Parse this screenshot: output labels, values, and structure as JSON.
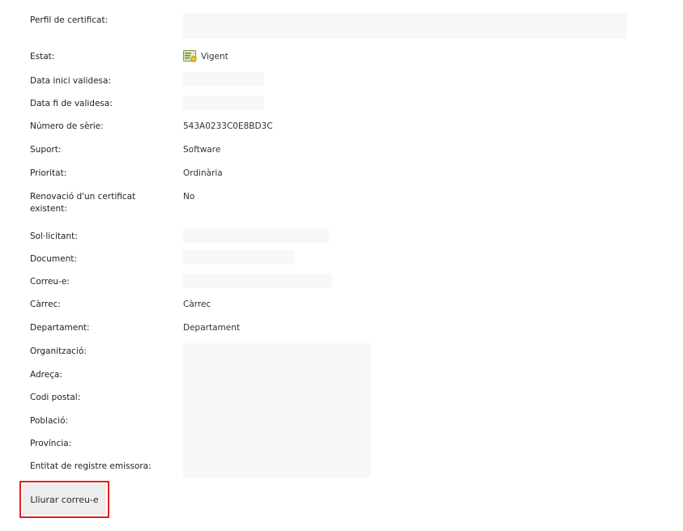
{
  "fields": {
    "perfil": {
      "label": "Perfil de certificat:"
    },
    "estat": {
      "label": "Estat:",
      "value": "Vigent",
      "icon": "certificate-icon"
    },
    "data_inici": {
      "label": "Data inici validesa:"
    },
    "data_fi": {
      "label": "Data fi de validesa:"
    },
    "numero_serie": {
      "label": "Número de sèrie:",
      "value": "543A0233C0E8BD3C"
    },
    "suport": {
      "label": "Suport:",
      "value": "Software"
    },
    "prioritat": {
      "label": "Prioritat:",
      "value": "Ordinària"
    },
    "renovacio": {
      "label": "Renovació d'un certificat existent:",
      "value": "No"
    },
    "sollicitant": {
      "label": "Sol·licitant:"
    },
    "document": {
      "label": "Document:"
    },
    "correu": {
      "label": "Correu-e:"
    },
    "carrec": {
      "label": "Càrrec:",
      "value": "Càrrec"
    },
    "departament": {
      "label": "Departament:",
      "value": "Departament"
    },
    "organitzacio": {
      "label": "Organització:"
    },
    "adreca": {
      "label": "Adreça:"
    },
    "codi_postal": {
      "label": "Codi postal:"
    },
    "poblacio": {
      "label": "Població:"
    },
    "provincia": {
      "label": "Província:"
    },
    "entitat": {
      "label": "Entitat de registre emissora:"
    }
  },
  "actions": {
    "send_email_label": "Lliurar correu-e"
  },
  "colors": {
    "highlight_border": "#e0201c",
    "button_bg": "#ededed",
    "redacted_bg": "#f8f8f8"
  }
}
